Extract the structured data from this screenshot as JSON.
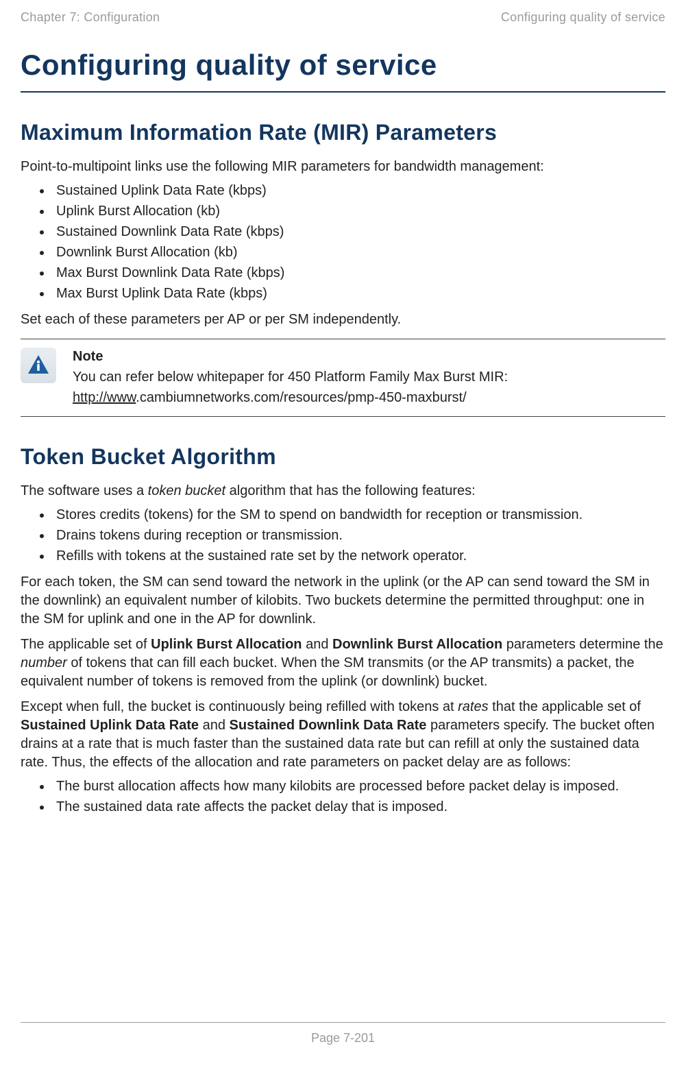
{
  "header": {
    "left": "Chapter 7:  Configuration",
    "right": "Configuring quality of service"
  },
  "titles": {
    "main": "Configuring quality of service",
    "section_mir": "Maximum Information Rate (MIR) Parameters",
    "section_token": "Token Bucket Algorithm"
  },
  "mir": {
    "intro": "Point-to-multipoint links use the following MIR parameters for bandwidth management:",
    "items": [
      "Sustained Uplink Data Rate (kbps)",
      "Uplink Burst Allocation (kb)",
      "Sustained Downlink Data Rate (kbps)",
      "Downlink Burst Allocation (kb)",
      "Max Burst Downlink Data Rate (kbps)",
      "Max Burst Uplink Data Rate (kbps)"
    ],
    "closing": "Set each of these parameters per AP or per SM independently."
  },
  "note": {
    "label": "Note",
    "line1": "You can refer below whitepaper for 450 Platform Family Max Burst MIR:",
    "link_underlined": "http://www",
    "link_rest": ".cambiumnetworks.com/resources/pmp-450-maxburst/"
  },
  "token": {
    "intro_prefix": "The software uses a ",
    "intro_italic": "token bucket",
    "intro_suffix": " algorithm that has the following features:",
    "items": [
      "Stores credits (tokens) for the SM to spend on bandwidth for reception or transmission.",
      "Drains tokens during reception or transmission.",
      "Refills with tokens at the sustained rate set by the network operator."
    ],
    "para_each_token": "For each token, the SM can send toward the network in the uplink (or the AP can send toward the SM in the downlink) an equivalent number of kilobits. Two buckets determine the permitted throughput: one in the SM for uplink and one in the AP for downlink.",
    "para_applicable": {
      "p1": "The applicable set of ",
      "b1": "Uplink Burst Allocation",
      "p2": " and ",
      "b2": "Downlink Burst Allocation",
      "p3": " parameters determine the ",
      "i1": "number",
      "p4": " of tokens that can fill each bucket. When the SM transmits (or the AP transmits) a packet, the equivalent number of tokens is removed from the uplink (or downlink) bucket."
    },
    "para_except": {
      "p1": "Except when full, the bucket is continuously being refilled with tokens at ",
      "i1": "rates",
      "p2": " that the applicable set of ",
      "b1": "Sustained Uplink Data Rate",
      "p3": " and ",
      "b2": "Sustained Downlink Data Rate",
      "p4": " parameters specify. The bucket often drains at a rate that is much faster than the sustained data rate but can refill at only the sustained data rate. Thus, the effects of the allocation and rate parameters on packet delay are as follows:"
    },
    "effects": [
      "The burst allocation affects how many kilobits are processed before packet delay is imposed.",
      "The sustained data rate affects the packet delay that is imposed."
    ]
  },
  "footer": "Page 7-201"
}
